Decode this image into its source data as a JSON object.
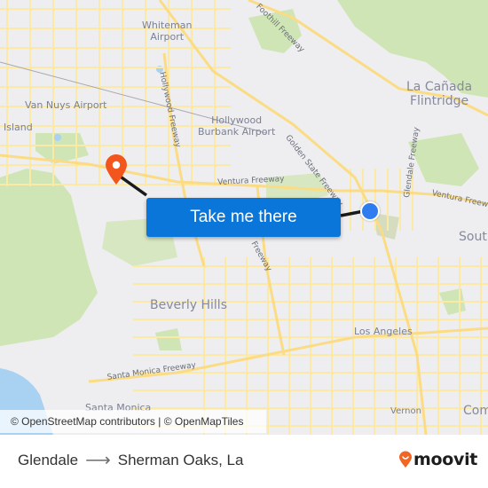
{
  "map": {
    "labels": {
      "whiteman_airport_1": "Whiteman",
      "whiteman_airport_2": "Airport",
      "foothill_freeway": "Foothill Freeway",
      "la_canada_1": "La Cañada",
      "la_canada_2": "Flintridge",
      "van_nuys_airport": "Van Nuys Airport",
      "island": "Island",
      "hollywood_freeway": "Hollywood Freeway",
      "burbank_airport_1": "Hollywood",
      "burbank_airport_2": "Burbank Airport",
      "golden_state_freeway": "Golden State Freeway",
      "glendale_freeway": "Glendale Freeway",
      "ventura_freeway_west": "Ventura Freeway",
      "ventura_freeway_east": "Ventura Freeway",
      "south_partial": "South",
      "beverly_hills": "Beverly Hills",
      "santa_monica_freeway": "Santa Monica Freeway",
      "santa_monica": "Santa Monica",
      "los_angeles": "Los Angeles",
      "vernon": "Vernon",
      "commerce_partial": "Com",
      "freeway_partial": "Freeway"
    },
    "origin": "Glendale",
    "destination": "Sherman Oaks, La",
    "colors": {
      "route_line": "#1a1a1a",
      "origin_dot": "#2f7bf0",
      "destination_pin": "#f2561d",
      "roads": "#fce9a3",
      "parks": "#cfe5b5",
      "water": "#a9d1f2",
      "cta": "#0a76d9"
    }
  },
  "attribution": "© OpenStreetMap contributors | © OpenMapTiles",
  "cta": {
    "label": "Take me there"
  },
  "footer": {
    "from": "Glendale",
    "arrow": "⟶",
    "to": "Sherman Oaks, La",
    "logo": "moovit",
    "logo_color": "#f26522"
  }
}
